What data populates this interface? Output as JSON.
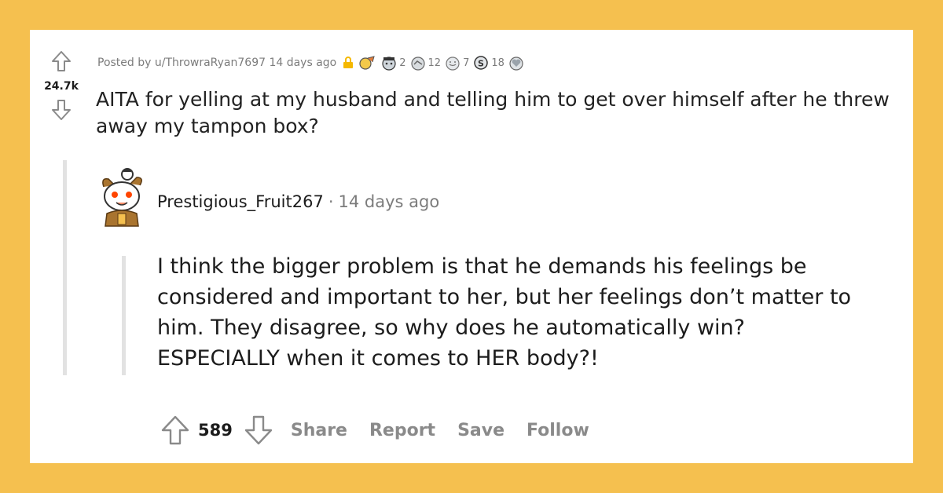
{
  "post": {
    "score": "24.7k",
    "meta_text": "Posted by u/ThrowraRyan7697 14 days ago",
    "awards": [
      {
        "icon": "lock-icon",
        "count": ""
      },
      {
        "icon": "award-rocket-icon",
        "count": ""
      },
      {
        "icon": "award-wholesome-icon",
        "count": "2"
      },
      {
        "icon": "award-helpful-icon",
        "count": "12"
      },
      {
        "icon": "award-silver-icon",
        "count": "7"
      },
      {
        "icon": "award-s-icon",
        "count": "18"
      },
      {
        "icon": "award-heart-icon",
        "count": ""
      }
    ],
    "title": "AITA for yelling at my husband and telling him to get over himself after he threw away my tampon box?"
  },
  "comment": {
    "author": "Prestigious_Fruit267",
    "separator": "·",
    "time": "14 days ago",
    "body": "I think the bigger problem is that he demands his feelings be considered and important to her, but her feelings don’t matter to him. They disagree, so why does he automatically win? ESPECIALLY when it comes to HER body?!",
    "score": "589",
    "actions": {
      "share": "Share",
      "report": "Report",
      "save": "Save",
      "follow": "Follow"
    }
  },
  "colors": {
    "background": "#f5c04f",
    "card": "#ffffff",
    "lock": "#f5b800",
    "thread_line": "#e2e2e2"
  }
}
